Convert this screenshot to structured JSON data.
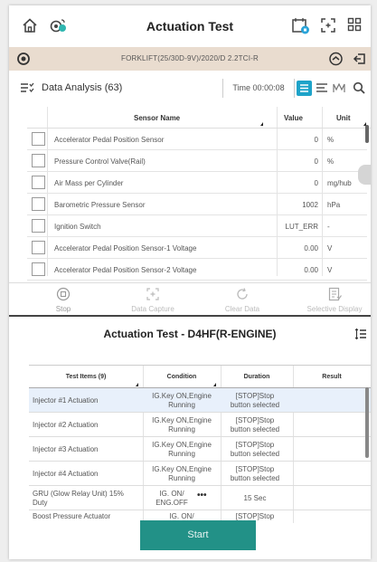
{
  "header": {
    "title": "Actuation Test"
  },
  "vehicle": {
    "name": "FORKLIFT(25/30D-9V)/2020/D 2.2TCI-R"
  },
  "data_analysis": {
    "label": "Data Analysis (63)",
    "time": "Time 00:00:08"
  },
  "sensor_table": {
    "headers": {
      "name": "Sensor Name",
      "value": "Value",
      "unit": "Unit"
    },
    "rows": [
      {
        "name": "Accelerator Pedal Position Sensor",
        "value": "0",
        "unit": "%"
      },
      {
        "name": "Pressure Control Valve(Rail)",
        "value": "0",
        "unit": "%"
      },
      {
        "name": "Air Mass per Cylinder",
        "value": "0",
        "unit": "mg/hub"
      },
      {
        "name": "Barometric Pressure Sensor",
        "value": "1002",
        "unit": "hPa"
      },
      {
        "name": "Ignition Switch",
        "value": "LUT_ERR",
        "unit": "-"
      },
      {
        "name": "Accelerator Pedal Position Sensor-1 Voltage",
        "value": "0.00",
        "unit": "V"
      },
      {
        "name": "Accelerator Pedal Position Sensor-2 Voltage",
        "value": "0.00",
        "unit": "V"
      }
    ]
  },
  "actions": {
    "stop": "Stop",
    "capture": "Data Capture",
    "clear": "Clear Data",
    "selective": "Selective Display"
  },
  "actuation": {
    "title": "Actuation Test  - D4HF(R-ENGINE)",
    "headers": {
      "items": "Test Items (9)",
      "condition": "Condition",
      "duration": "Duration",
      "result": "Result"
    },
    "rows": [
      {
        "name": "Injector #1 Actuation",
        "cond1": "IG.Key ON,Engine",
        "cond2": "Running",
        "dur1": "[STOP]Stop",
        "dur2": "button selected"
      },
      {
        "name": "Injector #2 Actuation",
        "cond1": "IG.Key ON,Engine",
        "cond2": "Running",
        "dur1": "[STOP]Stop",
        "dur2": "button selected"
      },
      {
        "name": "Injector #3 Actuation",
        "cond1": "IG.Key ON,Engine",
        "cond2": "Running",
        "dur1": "[STOP]Stop",
        "dur2": "button selected"
      },
      {
        "name": "Injector #4 Actuation",
        "cond1": "IG.Key ON,Engine",
        "cond2": "Running",
        "dur1": "[STOP]Stop",
        "dur2": "button selected"
      },
      {
        "name": "GRU (Glow Relay Unit) 15% Duty",
        "cond1": "IG. ON/",
        "cond2": "ENG.OFF",
        "dur1": "15 Sec",
        "dur2": ""
      },
      {
        "name": "Boost Pressure Actuator",
        "cond1": "IG. ON/",
        "cond2": "",
        "dur1": "[STOP]Stop",
        "dur2": ""
      }
    ]
  },
  "start": {
    "label": "Start"
  },
  "colors": {
    "accent": "#1ea3c9",
    "start": "#229187",
    "vehicle_bar": "#e9dccf",
    "selected_row": "#e8f0fb"
  }
}
